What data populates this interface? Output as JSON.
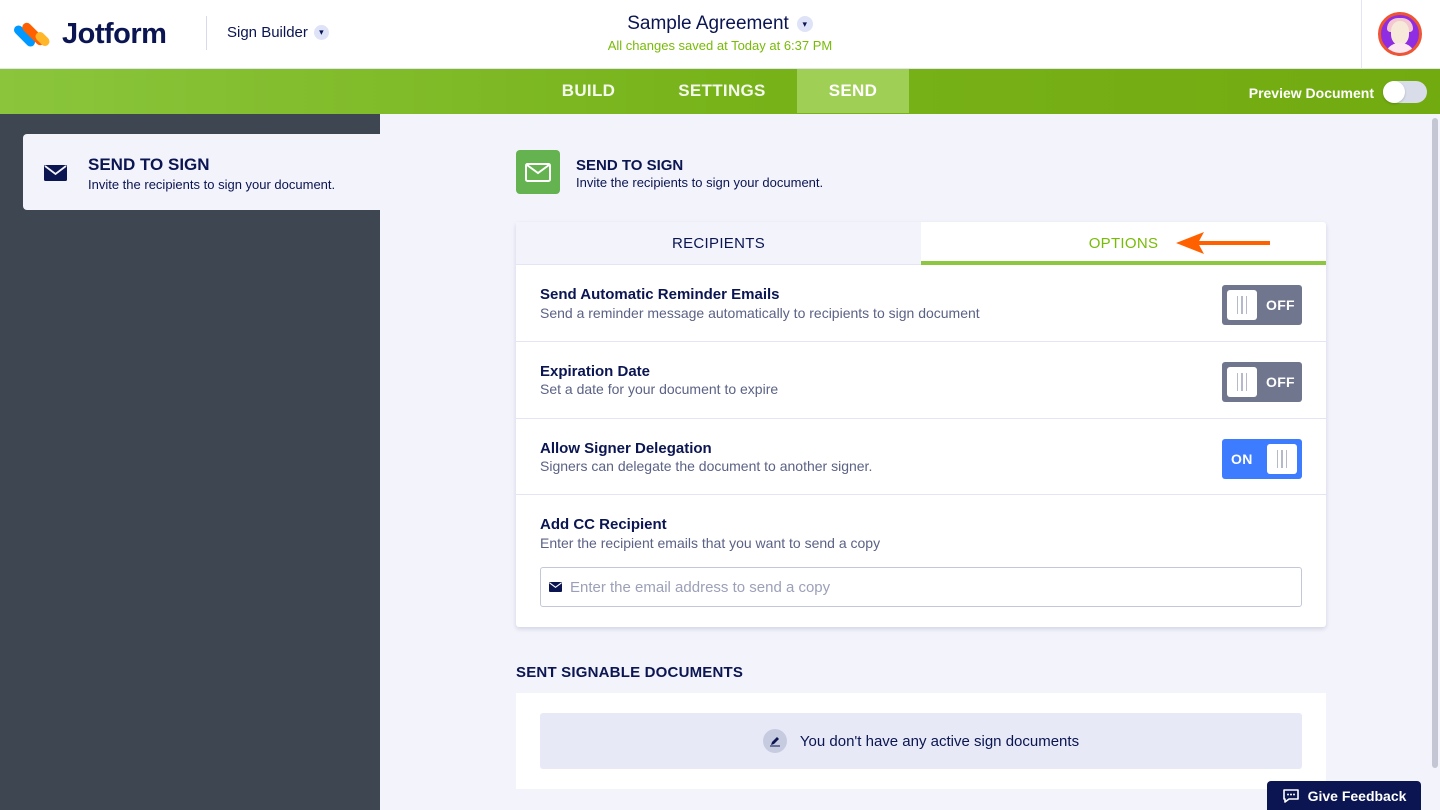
{
  "header": {
    "brand": "Jotform",
    "builder_label": "Sign Builder",
    "doc_title": "Sample Agreement",
    "saved_status": "All changes saved at Today at 6:37 PM"
  },
  "nav": {
    "tabs": [
      {
        "label": "BUILD"
      },
      {
        "label": "SETTINGS"
      },
      {
        "label": "SEND",
        "active": true
      }
    ],
    "preview_label": "Preview Document",
    "preview_enabled": false
  },
  "sidebar": {
    "items": [
      {
        "title": "SEND TO SIGN",
        "desc": "Invite the recipients to sign your document.",
        "icon": "envelope-icon"
      }
    ]
  },
  "main": {
    "title": "SEND TO SIGN",
    "desc": "Invite the recipients to sign your document.",
    "tabs": [
      {
        "label": "RECIPIENTS"
      },
      {
        "label": "OPTIONS",
        "active": true
      }
    ],
    "options": [
      {
        "title": "Send Automatic Reminder Emails",
        "desc": "Send a reminder message automatically to recipients to sign document",
        "state": "OFF"
      },
      {
        "title": "Expiration Date",
        "desc": "Set a date for your document to expire",
        "state": "OFF"
      },
      {
        "title": "Allow Signer Delegation",
        "desc": "Signers can delegate the document to another signer.",
        "state": "ON"
      }
    ],
    "cc": {
      "title": "Add CC Recipient",
      "desc": "Enter the recipient emails that you want to send a copy",
      "value": "",
      "placeholder": "Enter the email address to send a copy"
    },
    "sent": {
      "title": "SENT SIGNABLE DOCUMENTS",
      "empty_text": "You don't have any active sign documents"
    }
  },
  "feedback": {
    "label": "Give Feedback"
  },
  "colors": {
    "brand_navy": "#0a1551",
    "nav_green": "#78b31a",
    "options_green": "#78bb07",
    "switch_off": "#6f768e",
    "switch_on": "#3e7cff",
    "arrow_orange": "#ff6100"
  }
}
